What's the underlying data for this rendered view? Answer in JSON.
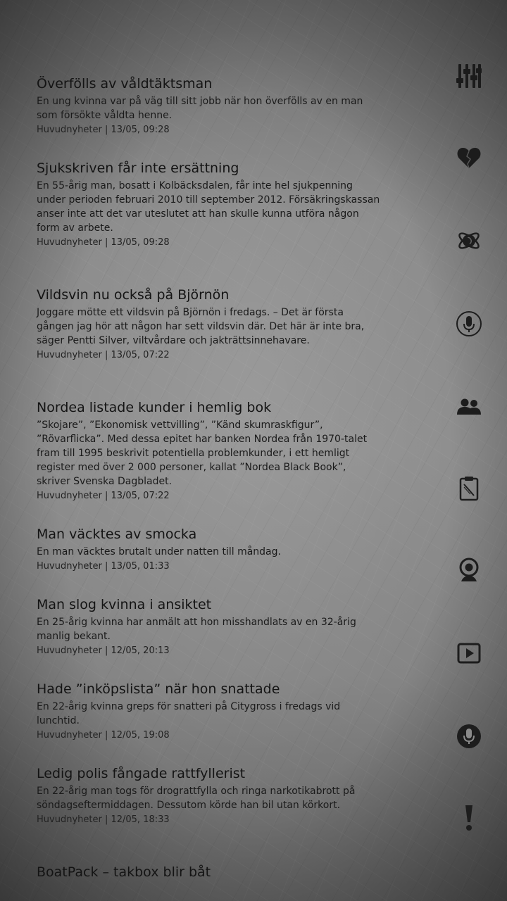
{
  "articles": [
    {
      "title": "Överfölls av våldtäktsman",
      "summary": "En ung kvinna var på väg till sitt jobb när hon överfölls av en man som försökte våldta henne.",
      "meta": "Huvudnyheter | 13/05, 09:28"
    },
    {
      "title": "Sjukskriven får inte ersättning",
      "summary": "En 55-årig man, bosatt i Kolbäcksdalen, får inte hel sjukpenning under perioden februari 2010 till september 2012. Försäkringskassan anser inte att det var uteslutet att han skulle kunna utföra någon form av arbete.",
      "meta": "Huvudnyheter | 13/05, 09:28"
    },
    {
      "title": "Vildsvin nu också på Björnön",
      "summary": "Joggare mötte ett vildsvin på Björnön i fredags. – Det är första gången jag hör att någon har sett vildsvin där. Det här är inte bra, säger Pentti Silver, viltvårdare och jakträttsinnehavare.",
      "meta": "Huvudnyheter | 13/05, 07:22"
    },
    {
      "title": "Nordea listade kunder i hemlig bok",
      "summary": "”Skojare”, ”Ekonomisk vettvilling”, ”Känd skumraskfigur”, ”Rövarflicka”. Med dessa epitet har banken Nordea från 1970-talet fram till 1995 beskrivit potentiella problemkunder, i ett hemligt register med över 2 000 personer, kallat ”Nordea Black Book”, skriver Svenska Dagbladet.",
      "meta": "Huvudnyheter | 13/05, 07:22"
    },
    {
      "title": "Man väcktes av smocka",
      "summary": "En man väcktes brutalt under natten till måndag.",
      "meta": "Huvudnyheter | 13/05, 01:33"
    },
    {
      "title": "Man slog kvinna i ansiktet",
      "summary": "En 25-årig kvinna har anmält att hon misshandlats av en 32-årig manlig bekant.",
      "meta": "Huvudnyheter | 12/05, 20:13"
    },
    {
      "title": "Hade ”inköpslista” när hon snattade",
      "summary": "En 22-årig kvinna greps för snatteri på Citygross i fredags vid lunchtid.",
      "meta": "Huvudnyheter | 12/05, 19:08"
    },
    {
      "title": "Ledig polis fångade rattfyllerist",
      "summary": "En 22-årig man togs för drograttfylla och ringa narkotikabrott på söndagseftermiddagen. Dessutom körde han bil utan körkort.",
      "meta": "Huvudnyheter | 12/05, 18:33"
    },
    {
      "title": "BoatPack – takbox blir båt",
      "summary": "",
      "meta": ""
    }
  ],
  "sidebar": {
    "icons": [
      "equalizer-icon",
      "broken-heart-icon",
      "globe-orbit-icon",
      "microphone-icon",
      "users-icon",
      "notepad-icon",
      "webcam-icon",
      "play-video-icon",
      "microphone-dark-icon",
      "exclamation-icon"
    ]
  }
}
